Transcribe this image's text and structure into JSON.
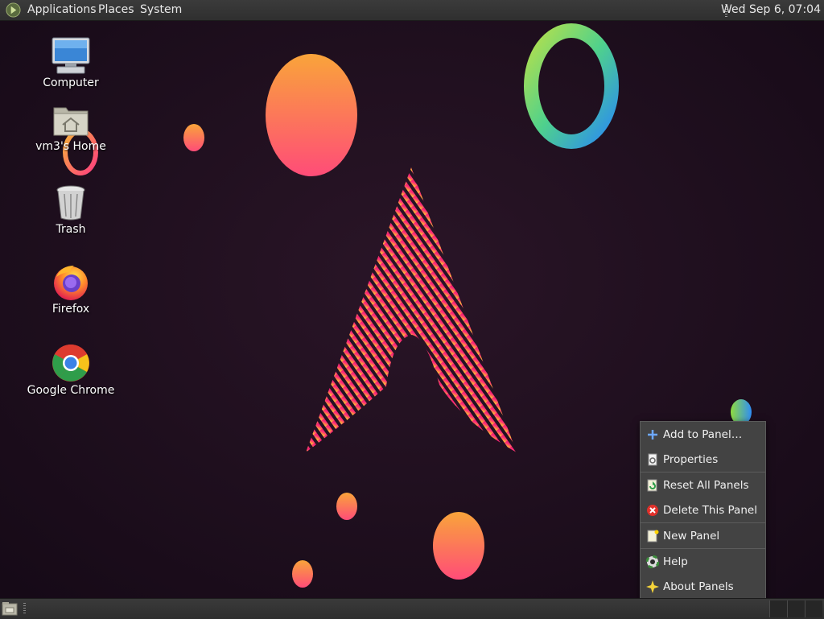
{
  "top_panel": {
    "menus": [
      {
        "label": "Applications"
      },
      {
        "label": "Places"
      },
      {
        "label": "System"
      }
    ],
    "clock": "Wed Sep  6, 07:04"
  },
  "desktop": {
    "icons": [
      {
        "label": "Computer",
        "icon": "computer-icon"
      },
      {
        "label": "vm3's Home",
        "icon": "home-folder-icon"
      },
      {
        "label": "Trash",
        "icon": "trash-icon"
      },
      {
        "label": "Firefox",
        "icon": "firefox-icon"
      },
      {
        "label": "Google Chrome",
        "icon": "chrome-icon"
      }
    ]
  },
  "context_menu": {
    "items": [
      {
        "label": "Add to Panel…",
        "icon": "add-icon"
      },
      {
        "label": "Properties",
        "icon": "properties-icon"
      },
      {
        "label": "Reset All Panels",
        "icon": "reset-icon"
      },
      {
        "label": "Delete This Panel",
        "icon": "delete-icon"
      },
      {
        "label": "New Panel",
        "icon": "new-panel-icon"
      },
      {
        "label": "Help",
        "icon": "help-icon"
      },
      {
        "label": "About Panels",
        "icon": "about-icon"
      }
    ]
  },
  "colors": {
    "wallpaper_bg": "#1d0f1e",
    "panel_bg": "#333333",
    "menu_bg": "#434343",
    "accent_orange": "#f8a23a",
    "accent_pink": "#ff3d7f"
  }
}
